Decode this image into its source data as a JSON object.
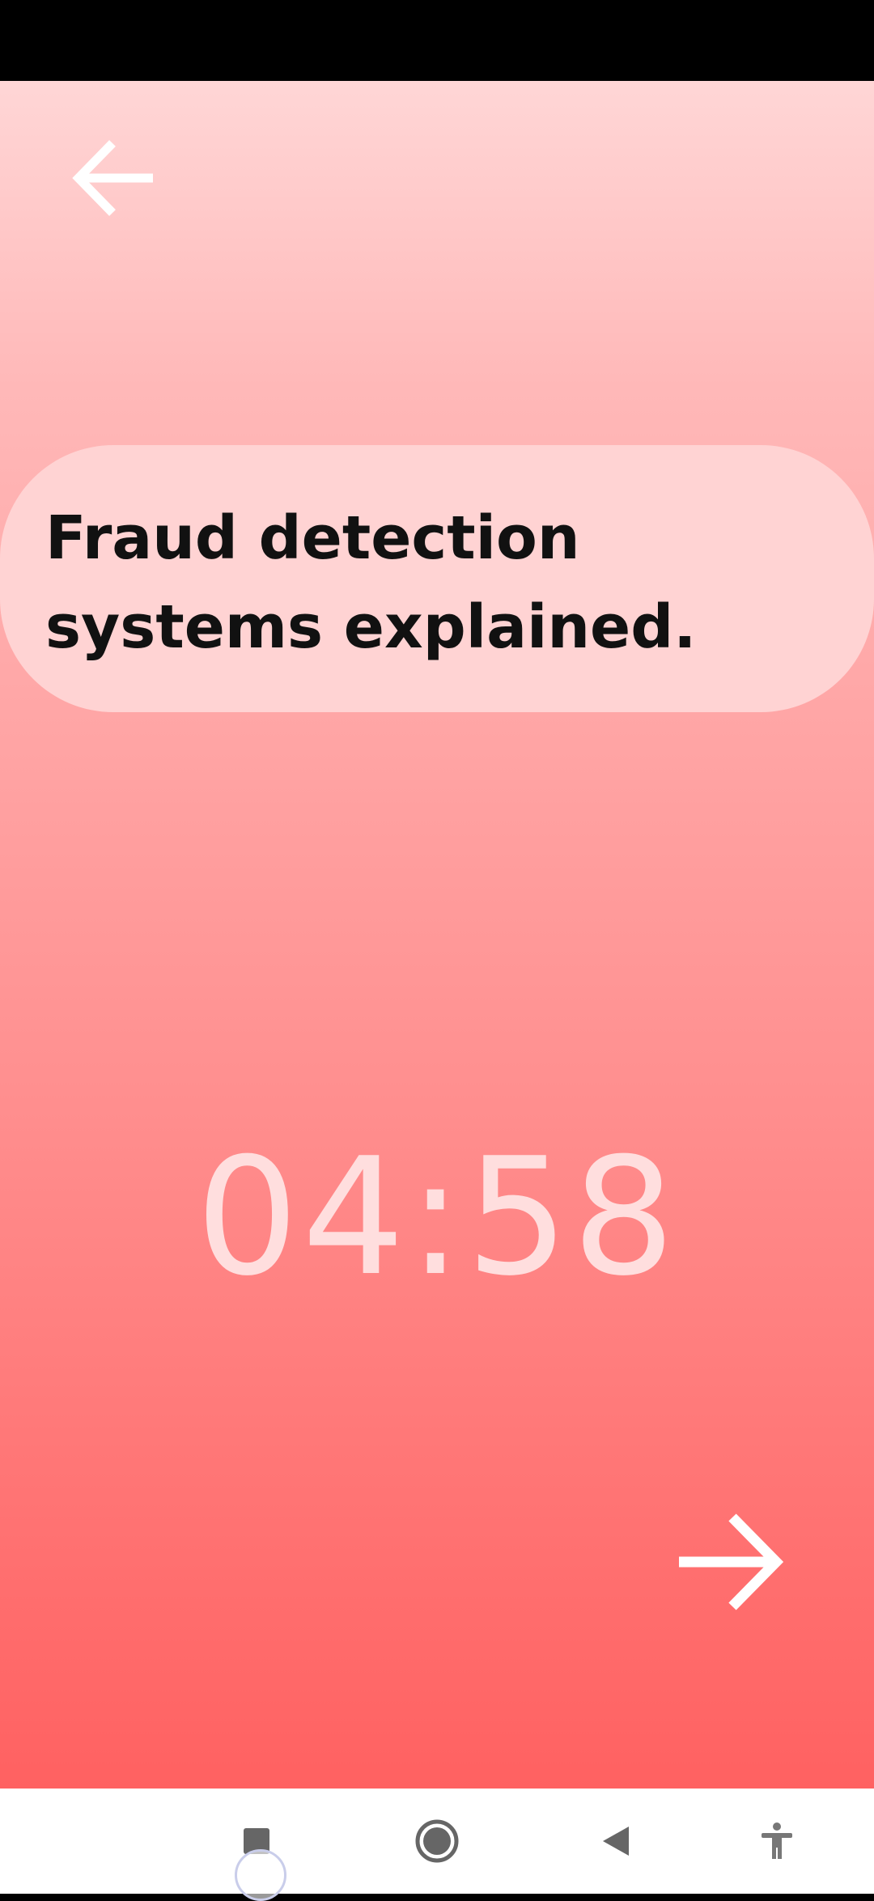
{
  "topic": {
    "title": "Fraud detection systems explained."
  },
  "timer": {
    "display": "04:58"
  },
  "icons": {
    "back": "arrow-left-icon",
    "next": "arrow-right-icon",
    "recents": "square-icon",
    "home": "circle-icon",
    "system_back": "triangle-back-icon",
    "accessibility": "accessibility-icon"
  },
  "colors": {
    "gradient_top": "#ffd6d6",
    "gradient_bottom": "#ff6161",
    "card_background": "#ffd3d3",
    "timer_text": "#ffdede",
    "title_text": "#111111",
    "arrow_color": "#ffffff",
    "nav_icon_color": "#666666"
  }
}
